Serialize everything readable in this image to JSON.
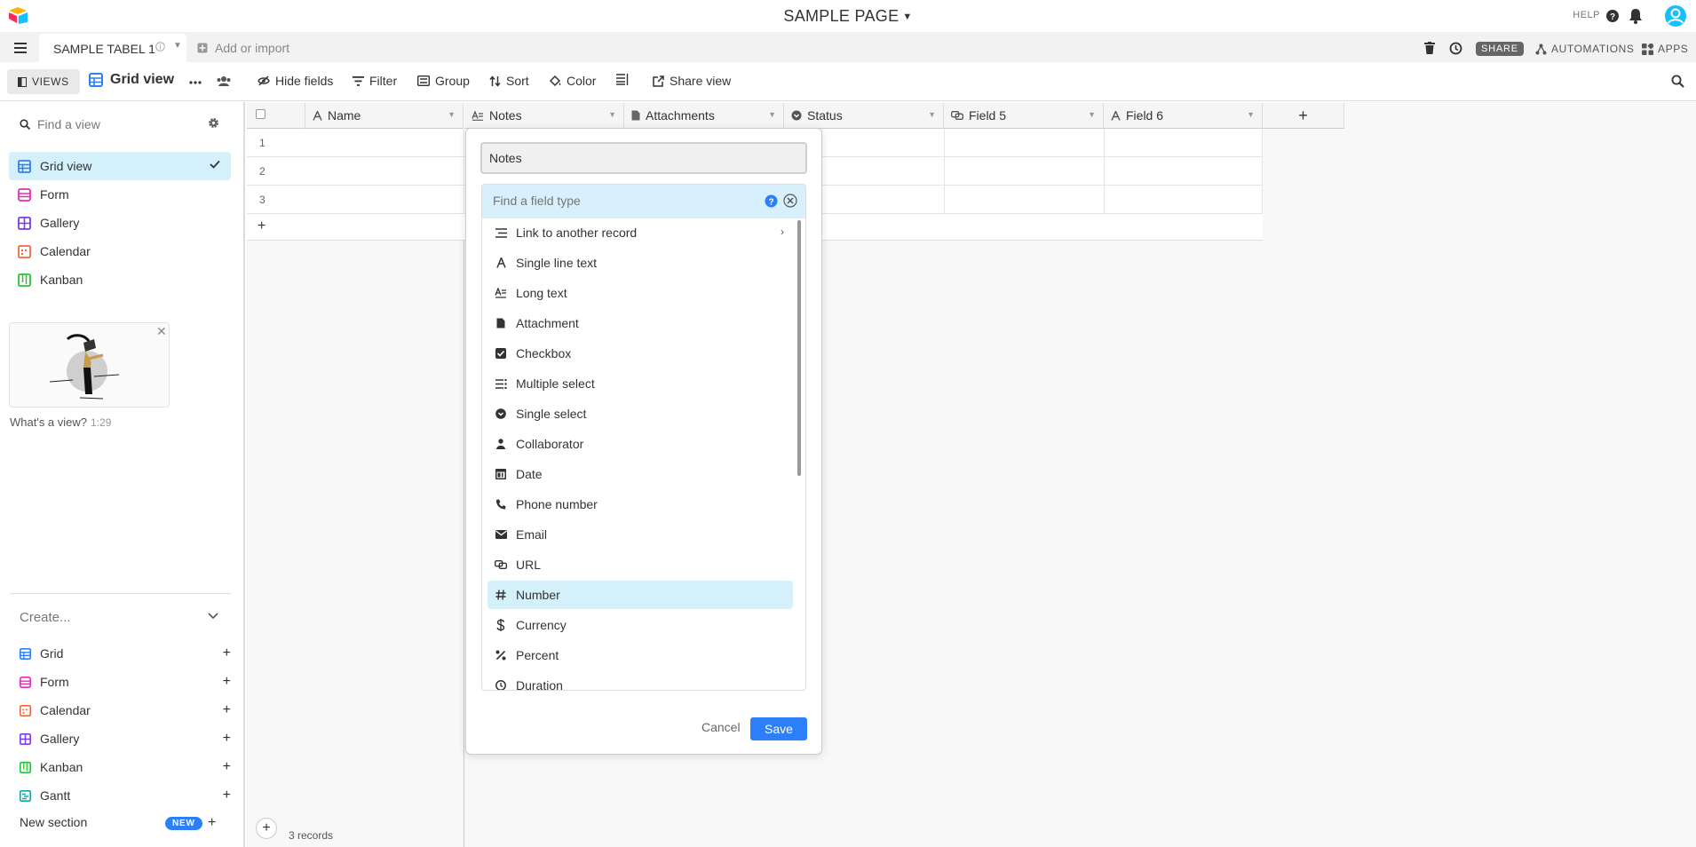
{
  "header": {
    "base_name": "SAMPLE PAGE",
    "help": "HELP"
  },
  "tabs": {
    "table_name": "SAMPLE TABEL 1",
    "add_or_import": "Add or import",
    "share": "SHARE",
    "automations": "AUTOMATIONS",
    "apps": "APPS"
  },
  "viewbar": {
    "views": "VIEWS",
    "current_view": "Grid view",
    "tools": [
      "Hide fields",
      "Filter",
      "Group",
      "Sort",
      "Color",
      "Share view"
    ]
  },
  "sidebar": {
    "find_placeholder": "Find a view",
    "views": [
      {
        "label": "Grid view",
        "icon": "grid-icon",
        "color": "#2d7ff9",
        "active": true
      },
      {
        "label": "Form",
        "icon": "form-icon",
        "color": "#e929ba"
      },
      {
        "label": "Gallery",
        "icon": "gallery-icon",
        "color": "#7c39ed"
      },
      {
        "label": "Calendar",
        "icon": "calendar-icon",
        "color": "#f7653b"
      },
      {
        "label": "Kanban",
        "icon": "kanban-icon",
        "color": "#20c933"
      }
    ],
    "promo_title": "What's a view?",
    "promo_duration": "1:29",
    "create_label": "Create...",
    "create_items": [
      {
        "label": "Grid",
        "color": "#2d7ff9"
      },
      {
        "label": "Form",
        "color": "#e929ba"
      },
      {
        "label": "Calendar",
        "color": "#f7653b"
      },
      {
        "label": "Gallery",
        "color": "#7c39ed"
      },
      {
        "label": "Kanban",
        "color": "#20c933"
      },
      {
        "label": "Gantt",
        "color": "#0fa9a3"
      }
    ],
    "new_section": "New section",
    "new_badge": "NEW"
  },
  "grid": {
    "columns": [
      "Name",
      "Notes",
      "Attachments",
      "Status",
      "Field 5",
      "Field 6"
    ],
    "rows": [
      "1",
      "2",
      "3"
    ],
    "record_count": "3 records"
  },
  "dialog": {
    "field_name": "Notes",
    "search_placeholder": "Find a field type",
    "types": [
      "Link to another record",
      "Single line text",
      "Long text",
      "Attachment",
      "Checkbox",
      "Multiple select",
      "Single select",
      "Collaborator",
      "Date",
      "Phone number",
      "Email",
      "URL",
      "Number",
      "Currency",
      "Percent",
      "Duration"
    ],
    "selected_type": "Number",
    "cancel": "Cancel",
    "save": "Save"
  },
  "colors": {
    "accent": "#2d7ff9",
    "selection": "#d4f0fb"
  }
}
